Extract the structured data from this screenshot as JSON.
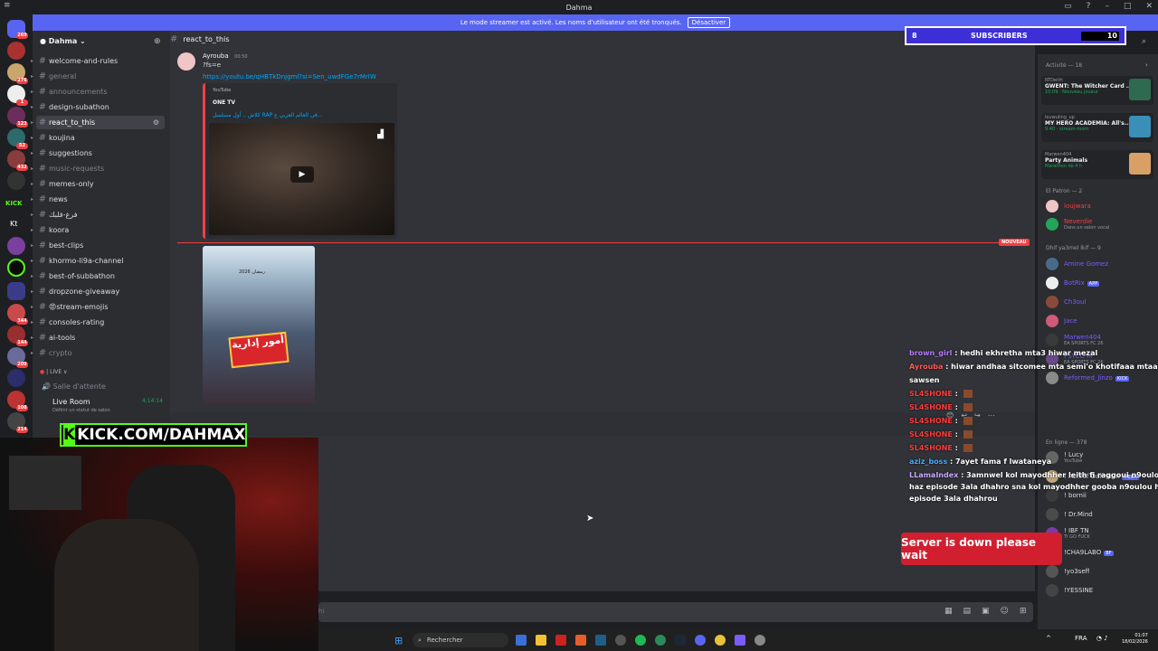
{
  "window": {
    "title": "Dahma",
    "menu": "≡"
  },
  "banner": {
    "text": "Le mode streamer est activé. Les noms d'utilisateur ont été tronqués.",
    "button": "Désactiver"
  },
  "rail": {
    "badges": [
      "269",
      "276",
      "1",
      "123",
      "52",
      "432",
      "344",
      "144",
      "209",
      "108",
      "214"
    ],
    "kick_label": "KICK",
    "kt_label": "Kt"
  },
  "guild": {
    "name": "Dahma"
  },
  "channels": [
    {
      "name": "welcome-and-rules",
      "muted": false
    },
    {
      "name": "general",
      "muted": true
    },
    {
      "name": "announcements",
      "muted": true
    },
    {
      "name": "design-subathon",
      "muted": false
    },
    {
      "name": "react_to_this",
      "muted": false,
      "active": true
    },
    {
      "name": "koujina",
      "muted": false
    },
    {
      "name": "suggestions",
      "muted": false
    },
    {
      "name": "music-requests",
      "muted": true
    },
    {
      "name": "memes-only",
      "muted": false
    },
    {
      "name": "news",
      "muted": false
    },
    {
      "name": "فرغ-قلبك",
      "muted": false
    },
    {
      "name": "koora",
      "muted": false
    },
    {
      "name": "best-clips",
      "muted": false
    },
    {
      "name": "khormo-li9a-channel",
      "muted": false
    },
    {
      "name": "best-of-subbathon",
      "muted": false
    },
    {
      "name": "dropzone-giveaway",
      "muted": false
    },
    {
      "name": "😡stream-emojis",
      "muted": false
    },
    {
      "name": "consoles-rating",
      "muted": false
    },
    {
      "name": "ai-tools",
      "muted": false
    },
    {
      "name": "crypto",
      "muted": true
    }
  ],
  "live_section": {
    "label": "| LIVE ∨",
    "waiting_room": "Salle d'attente",
    "live_room": "Live Room",
    "live_time": "4:14:14",
    "status": "Définir un statut de salon"
  },
  "header": {
    "channel": "react_to_this"
  },
  "message": {
    "author": "Ayrouba",
    "time": "00:50",
    "text": "?fs=e",
    "link": "https://youtu.be/qHBTkDnjgml?si=Sen_uwdFGe7rMrIW"
  },
  "embed": {
    "provider": "YouTube",
    "channel": "ONE TV",
    "title": "كلاش .. أول مسلسل RAP في العالم العربي ع..."
  },
  "new_badge": "NOUVEAU",
  "poster": {
    "title": "أمور إدارية",
    "top": "رمضان 2026"
  },
  "subs_widget": {
    "left": "8",
    "label": "SUBSCRIBERS",
    "right": "10"
  },
  "chat": [
    {
      "user": "brown_girl",
      "user_color": "#b77bff",
      "text": "hedhi ekhretha mta3 hiwar mezal"
    },
    {
      "user": "Ayrouba",
      "user_color": "#ff5a5a",
      "text": "hiwar andhaa sitcomee mta semi'o khotifaaa mtaa"
    },
    {
      "user": "",
      "user_color": "#fff",
      "text": "sawsen"
    },
    {
      "user": "SL4SHONE",
      "user_color": "#ff3b3b",
      "text": ""
    },
    {
      "user": "SL4SHONE",
      "user_color": "#ff3b3b",
      "text": ""
    },
    {
      "user": "SL4SHONE",
      "user_color": "#ff3b3b",
      "text": ""
    },
    {
      "user": "SL4SHONE",
      "user_color": "#ff3b3b",
      "text": ""
    },
    {
      "user": "SL4SHONE",
      "user_color": "#ff3b3b",
      "text": ""
    },
    {
      "user": "aziz_boss",
      "user_color": "#4aa8ff",
      "text": "7ayet fama f lwataneya"
    },
    {
      "user": "LLamaIndex",
      "user_color": "#c8a8ff",
      "text": "3amnwel kol mayodhher leith fi raggoui n9oulou"
    },
    {
      "user": "",
      "user_color": "#fff",
      "text": "haz episode 3ala dhahro sna kol mayodhher gooba n9oulou haz"
    },
    {
      "user": "",
      "user_color": "#fff",
      "text": "episode 3ala dhahrou"
    }
  ],
  "server_down": "Server is down please wait",
  "kick_overlay": {
    "k": "K",
    "text": "KICK.COM/DAHMAX"
  },
  "members": {
    "activity_head": "Activité — 18",
    "activities": [
      {
        "user": "RTDeith",
        "title": "GWENT: The Witcher Card ...",
        "status": "10:09 · Nouveau joueur",
        "color": "#2d6a4f"
      },
      {
        "user": "leuwuling_up",
        "title": "MY HERO ACADEMIA: All's...",
        "status": "9:40 · stream-room",
        "color": "#3a8fb7"
      },
      {
        "user": "Marwen404",
        "title": "Party Animals",
        "status": "Marathon de 4 h",
        "color": "#d9a066"
      }
    ],
    "patron_head": "El Patron — 2",
    "patron": [
      {
        "name": "loujwara",
        "color": "#f23f43",
        "sub": ""
      },
      {
        "name": "Neverdie",
        "color": "#f23f43",
        "sub": "Dans un salon vocal"
      }
    ],
    "dhif_head": "Dhif ya3mel lkif — 9",
    "dhif": [
      {
        "name": "Amine Gomez",
        "color": "#7a5cff",
        "sub": ""
      },
      {
        "name": "BotRix",
        "color": "#7a5cff",
        "sub": "",
        "tag": "APP"
      },
      {
        "name": "Ch3oul",
        "color": "#7a5cff",
        "sub": ""
      },
      {
        "name": "Jace",
        "color": "#7a5cff",
        "sub": ""
      },
      {
        "name": "Marwen404",
        "color": "#7a5cff",
        "sub": "EA SPORTS FC 26"
      },
      {
        "name": "PSYCO-M",
        "color": "#7a5cff",
        "sub": "EA SPORTS FC 26"
      },
      {
        "name": "Reformed_Jinzo",
        "color": "#7a5cff",
        "sub": "",
        "tag": "KICK"
      }
    ],
    "online_head": "En ligne — 378",
    "online": [
      {
        "name": "! Lucy",
        "color": "#dbdee1",
        "sub": "YouTube"
      },
      {
        "name": "! Achref Dahmani",
        "color": "#dbdee1",
        "sub": "",
        "tag": "MEGA"
      },
      {
        "name": "! bornii",
        "color": "#dbdee1",
        "sub": ""
      },
      {
        "name": "! Dr.Mind",
        "color": "#dbdee1",
        "sub": ""
      },
      {
        "name": "! IBF TN",
        "color": "#dbdee1",
        "sub": "TI GO FUCK"
      },
      {
        "name": "!CHA9LABO",
        "color": "#dbdee1",
        "sub": "",
        "tag": "BF"
      },
      {
        "name": "!yo3seff",
        "color": "#dbdee1",
        "sub": ""
      },
      {
        "name": "!YESSINE",
        "color": "#dbdee1",
        "sub": ""
      }
    ]
  },
  "composer": {
    "placeholder": "hi"
  },
  "taskbar": {
    "search": "Rechercher",
    "lang": "FRA",
    "time": "01:07",
    "date": "18/02/2026"
  }
}
